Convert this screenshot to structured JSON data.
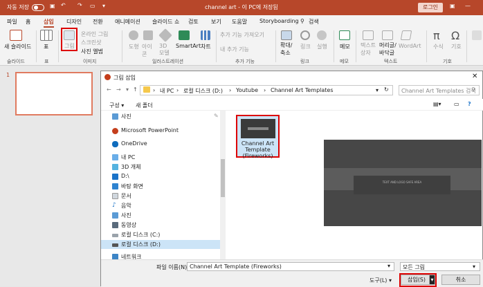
{
  "titlebar": {
    "autosave": "자동 저장",
    "autosave_state": "끔",
    "doc_title": "channel art - 이 PC에 저장됨",
    "login": "로그인"
  },
  "tabs": [
    "파일",
    "홈",
    "삽입",
    "디자인",
    "전환",
    "애니메이션",
    "슬라이드 쇼",
    "검토",
    "보기",
    "도움말",
    "Storyboarding",
    "검색"
  ],
  "ribbon": {
    "new_slide": "새 슬라이드",
    "table": "표",
    "picture": "그림",
    "online_picture": "온라인 그림",
    "screenshot": "스크린샷",
    "photo_album": "사진 앨범",
    "shapes": "도형",
    "icons": "아이콘",
    "model3d": "3D 모델",
    "smartart": "SmartArt",
    "chart": "차트",
    "get_addins": "추가 기능 가져오기",
    "my_addins": "내 추가 기능",
    "zoom": "확대/축소",
    "link": "링크",
    "action": "실행",
    "comment": "메모",
    "textbox": "텍스트 상자",
    "header_footer": "머리글/바닥글",
    "wordart": "WordArt",
    "equation": "수식",
    "symbol": "기호",
    "groups": {
      "slides": "슬라이드",
      "tables": "표",
      "images": "이미지",
      "illustrations": "일러스트레이션",
      "addins": "추가 기능",
      "links": "링크",
      "comments": "메모",
      "text": "텍스트",
      "symbols": "기호"
    }
  },
  "slide_number": "1",
  "dialog": {
    "title": "그림 삽입",
    "path": [
      "내 PC",
      "로컬 디스크 (D:)",
      "Youtube",
      "Channel Art Templates"
    ],
    "search_placeholder": "Channel Art Templates 검색",
    "organize": "구성 ▾",
    "new_folder": "새 폴더",
    "nav": [
      "사진",
      "Microsoft PowerPoint",
      "OneDrive",
      "내 PC",
      "3D 개체",
      "D:\\",
      "바탕 화면",
      "문서",
      "음악",
      "사진",
      "동영상",
      "로컬 디스크 (C:)",
      "로컬 디스크 (D:)",
      "네트워크"
    ],
    "file_name": "Channel Art Template (Fireworks)",
    "preview_text": "TEXT AND LOGO SAFE AREA",
    "filename_label": "파일 이름(N):",
    "filename_value": "Channel Art Template (Fireworks)",
    "filetype": "모든 그림",
    "tools": "도구(L) ▾",
    "insert": "삽입(S)",
    "cancel": "취소"
  }
}
